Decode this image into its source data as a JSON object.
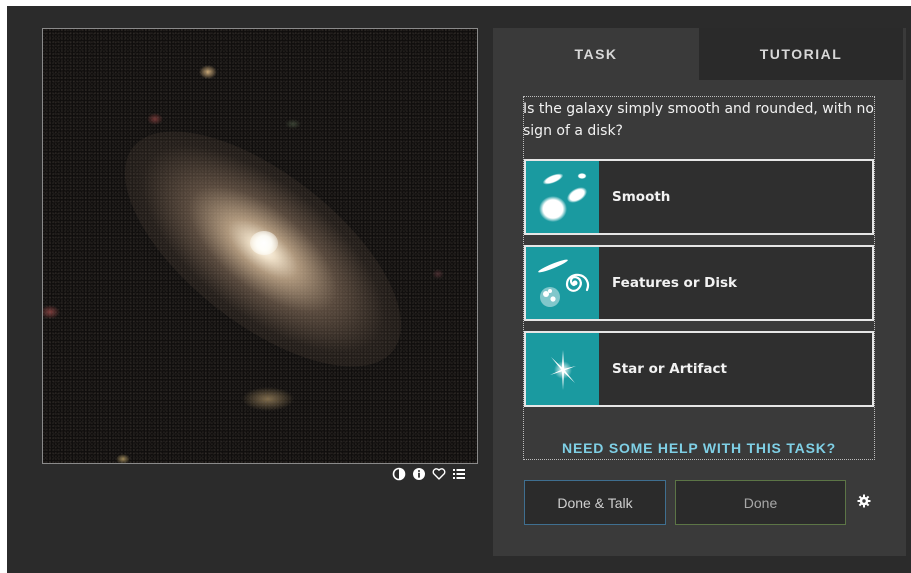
{
  "viewer": {
    "icons": [
      "invert-icon",
      "info-icon",
      "favorite-heart-icon",
      "collections-list-icon"
    ]
  },
  "tabs": {
    "task": "TASK",
    "tutorial": "TUTORIAL"
  },
  "task": {
    "question": "Is the galaxy simply smooth and rounded, with no sign of a disk?",
    "answers": [
      {
        "label": "Smooth",
        "icon": "smooth-galaxies-icon"
      },
      {
        "label": "Features or Disk",
        "icon": "spiral-disk-galaxy-icon"
      },
      {
        "label": "Star or Artifact",
        "icon": "star-artifact-icon"
      }
    ],
    "help_link": "NEED SOME HELP WITH THIS TASK?"
  },
  "buttons": {
    "done_talk": "Done & Talk",
    "done": "Done"
  },
  "colors": {
    "answer_thumb": "#1a9aa0",
    "help_link": "#7fd0e6",
    "done_talk_border": "#3f6f90",
    "done_border": "#5c7546"
  }
}
